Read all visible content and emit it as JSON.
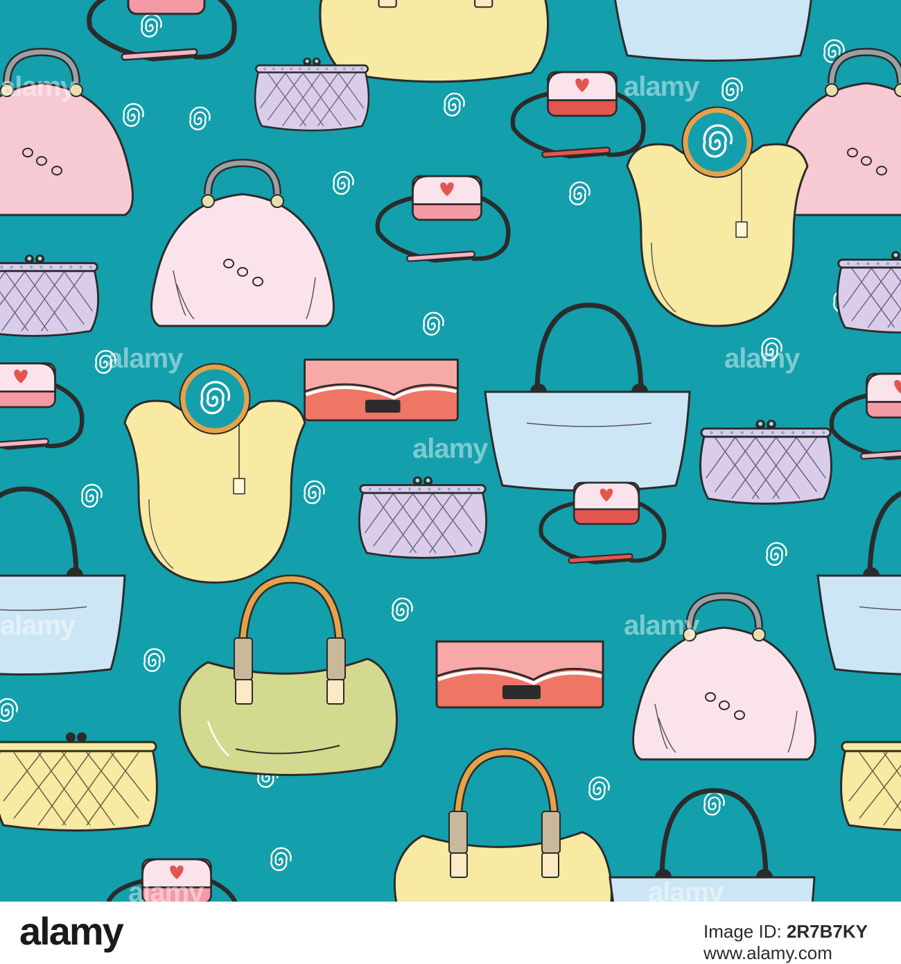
{
  "image": {
    "background_color": "#139fab",
    "watermark_text": "alamy",
    "bag_colors": {
      "pink": "#f7c9d3",
      "light_pink": "#fbe3ec",
      "lavender": "#d9cdea",
      "yellow": "#f8e9a3",
      "blue": "#cde6f5",
      "coral": "#ef7565",
      "coral_light": "#f6a9a6",
      "olive": "#d3d98e",
      "red": "#e2564f",
      "outline": "#2b2b2b"
    }
  },
  "footer": {
    "logo_text": "alamy",
    "image_id_label": "Image ID:",
    "image_id_value": "2R7B7KY",
    "site": "www.alamy.com"
  }
}
